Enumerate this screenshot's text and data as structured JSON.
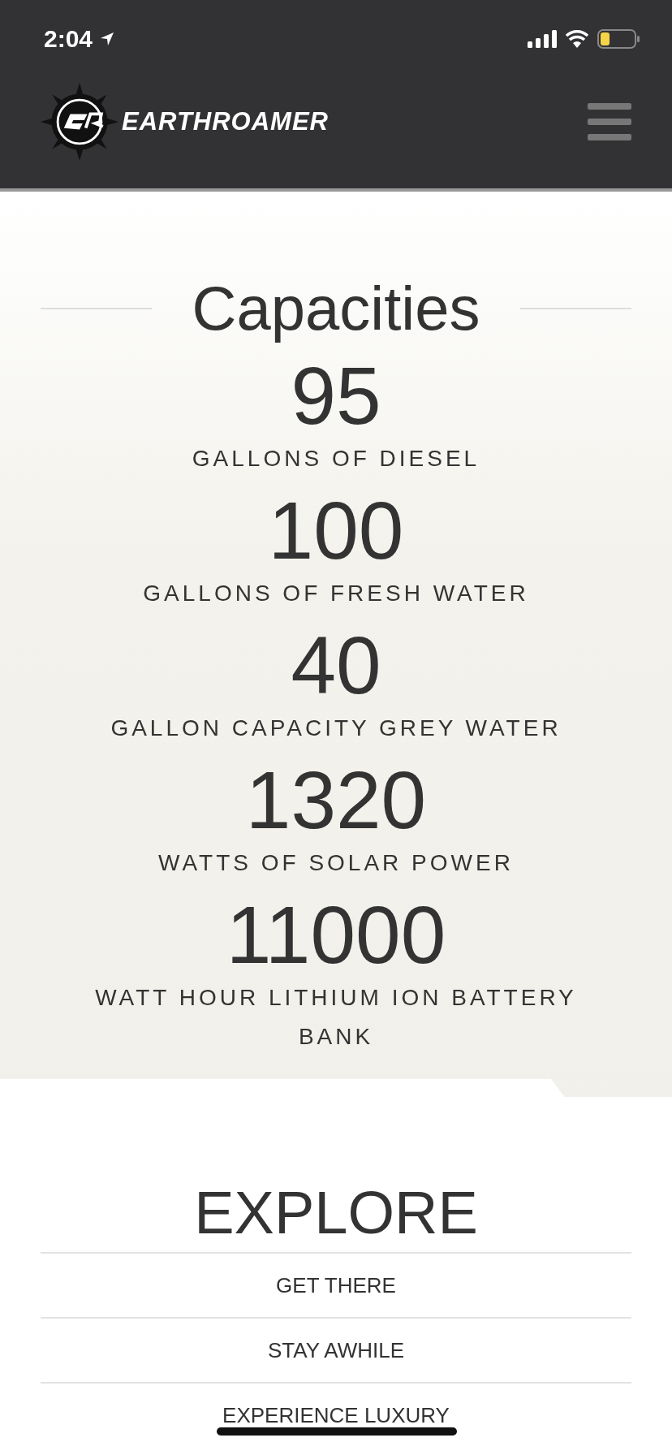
{
  "status_bar": {
    "time": "2:04"
  },
  "header": {
    "logo_text": "EARTHROAMER"
  },
  "capacities": {
    "title": "Capacities",
    "items": [
      {
        "value": "95",
        "label": "GALLONS OF DIESEL"
      },
      {
        "value": "100",
        "label": "GALLONS OF FRESH WATER"
      },
      {
        "value": "40",
        "label": "GALLON CAPACITY GREY WATER"
      },
      {
        "value": "1320",
        "label": "WATTS OF SOLAR POWER"
      },
      {
        "value": "11000",
        "label": "WATT HOUR LITHIUM ION BATTERY BANK"
      }
    ]
  },
  "explore": {
    "title": "EXPLORE",
    "links": [
      "GET THERE",
      "STAY AWHILE",
      "EXPERIENCE LUXURY"
    ]
  }
}
